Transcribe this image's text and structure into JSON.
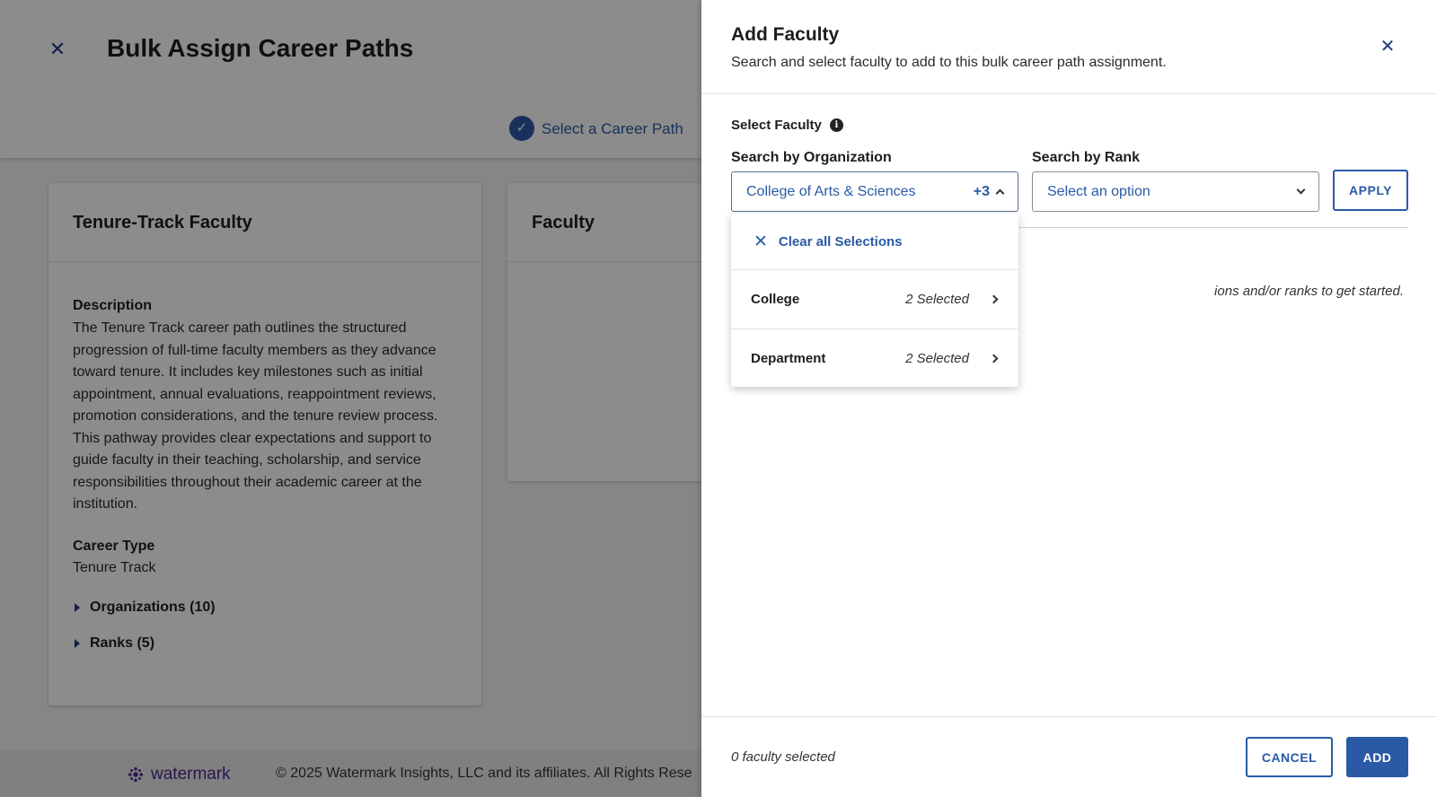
{
  "background": {
    "title": "Bulk Assign Career Paths",
    "step": {
      "label": "Select a Career Path",
      "check_glyph": "✓"
    },
    "card1": {
      "title": "Tenure-Track Faculty",
      "description_label": "Description",
      "description": "The Tenure Track career path outlines the structured progression of full-time faculty members as they advance toward tenure. It includes key milestones such as initial appointment, annual evaluations, reappointment reviews, promotion considerations, and the tenure review process. This pathway provides clear expectations and support to guide faculty in their teaching, scholarship, and service responsibilities throughout their academic career at the institution.",
      "career_type_label": "Career Type",
      "career_type": "Tenure Track",
      "organizations": "Organizations (10)",
      "ranks": "Ranks (5)"
    },
    "card2": {
      "title": "Faculty"
    },
    "footer": {
      "logo_text": "watermark",
      "copyright": "© 2025 Watermark Insights, LLC and its affiliates. All Rights Rese"
    }
  },
  "panel": {
    "title": "Add Faculty",
    "subtitle": "Search and select faculty to add to this bulk career path assignment.",
    "select_faculty_label": "Select Faculty",
    "org_label": "Search by Organization",
    "org_value": "College of Arts & Sciences",
    "org_extra": "+3",
    "rank_label": "Search by Rank",
    "rank_placeholder": "Select an option",
    "apply": "APPLY",
    "hint": "ions and/or ranks to get started.",
    "menu": {
      "clear": "Clear all Selections",
      "rows": [
        {
          "name": "College",
          "selected": "2 Selected"
        },
        {
          "name": "Department",
          "selected": "2 Selected"
        }
      ]
    },
    "footer": {
      "count": "0 faculty selected",
      "cancel": "CANCEL",
      "add": "ADD"
    }
  },
  "colors": {
    "accent": "#2a5aa5",
    "brand": "#4b2a8a"
  }
}
